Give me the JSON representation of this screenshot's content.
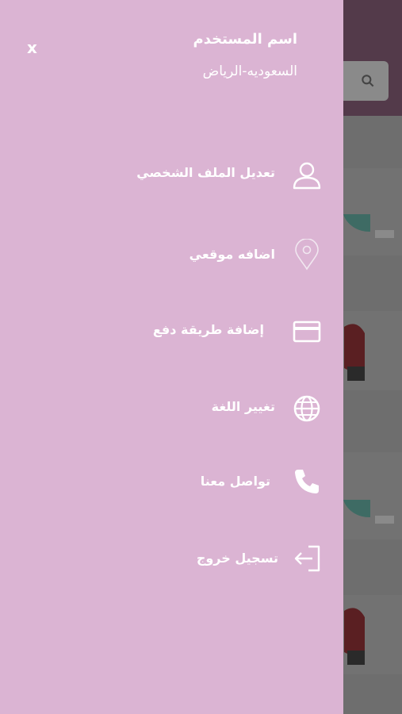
{
  "drawer": {
    "close_label": "x",
    "user_name": "اسم المستخدم",
    "user_location": "السعوديه-الرياض"
  },
  "menu": [
    {
      "label": "تعديل الملف الشخصي",
      "icon": "user-icon"
    },
    {
      "label": "اضافه موقعي",
      "icon": "location-pin-icon"
    },
    {
      "label": "إضافة طريقة دفع",
      "icon": "credit-card-icon"
    },
    {
      "label": "تغيير اللغة",
      "icon": "globe-icon"
    },
    {
      "label": "تواصل معنا",
      "icon": "phone-icon"
    },
    {
      "label": "تسجيل خروج",
      "icon": "logout-icon"
    }
  ],
  "colors": {
    "drawer_bg": "#dbb4d3",
    "header_bg": "#533a4a",
    "text": "#ffffff"
  }
}
